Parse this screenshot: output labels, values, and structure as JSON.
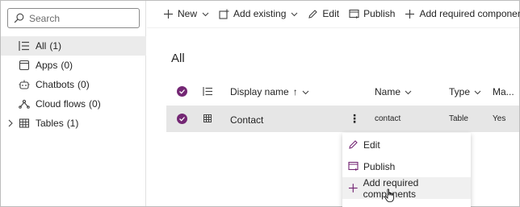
{
  "search": {
    "placeholder": "Search"
  },
  "sidebar": {
    "items": [
      {
        "label": "All",
        "count": "(1)",
        "icon": "list-icon",
        "selected": true
      },
      {
        "label": "Apps",
        "count": "(0)",
        "icon": "apps-icon"
      },
      {
        "label": "Chatbots",
        "count": "(0)",
        "icon": "chatbot-icon"
      },
      {
        "label": "Cloud flows",
        "count": "(0)",
        "icon": "cloud-flow-icon"
      },
      {
        "label": "Tables",
        "count": "(1)",
        "icon": "table-icon",
        "expandable": true
      }
    ]
  },
  "toolbar": {
    "new_label": "New",
    "add_existing_label": "Add existing",
    "edit_label": "Edit",
    "publish_label": "Publish",
    "add_required_label": "Add required components"
  },
  "main": {
    "title": "All",
    "columns": {
      "display_name": "Display name",
      "display_name_sort": "↑",
      "name": "Name",
      "type": "Type",
      "managed": "Ma..."
    },
    "rows": [
      {
        "display_name": "Contact",
        "more": "⋮",
        "name": "contact",
        "type": "Table",
        "managed": "Yes"
      }
    ]
  },
  "context_menu": {
    "items": [
      {
        "label": "Edit",
        "icon": "edit-icon"
      },
      {
        "label": "Publish",
        "icon": "publish-icon"
      },
      {
        "label": "Add required components",
        "icon": "plus-icon"
      }
    ]
  },
  "colors": {
    "accent": "#742774",
    "selected_bg": "#ebebeb",
    "row_selected_bg": "#e6e6e6"
  }
}
